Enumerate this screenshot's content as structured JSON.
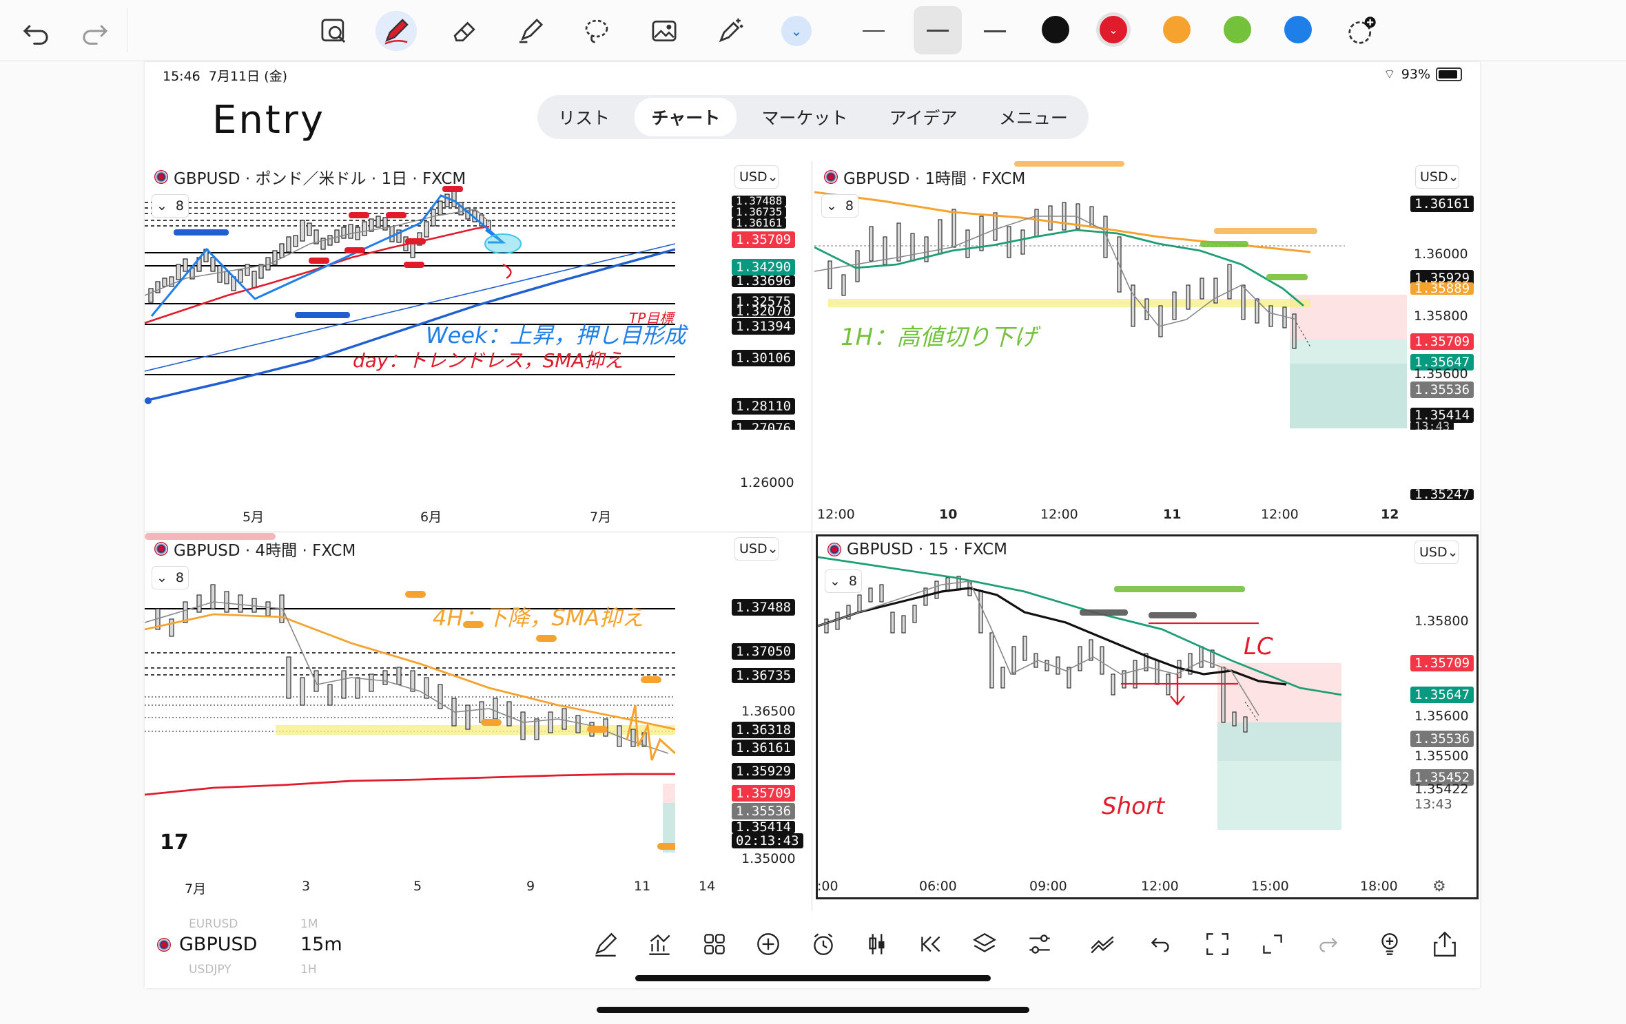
{
  "status": {
    "time": "15:46",
    "date": "7月11日 (金)",
    "battery": "93%"
  },
  "note": {
    "entry": "Entry",
    "week": "Week：上昇，押し目形成",
    "day": "day：トレンドレス，SMA抑え",
    "tp": "TP目標",
    "h1": "1H：高値切り下げ",
    "h4": "4H：下降，SMA抑え",
    "lc": "LC",
    "short": "Short"
  },
  "nav": [
    "リスト",
    "チャート",
    "マーケット",
    "アイデア",
    "メニュー"
  ],
  "currency": "USD",
  "indicators": "8",
  "colors": {
    "red": "#e01b2b",
    "orange": "#f5a22e",
    "green": "#74c13b",
    "blue": "#1f7fe8",
    "tv_red": "#f23645",
    "tv_green": "#089981"
  },
  "chart_data": [
    {
      "type": "candlestick",
      "title": "GBPUSD · ポンド／米ドル · 1日 · FXCM",
      "x_ticks": [
        "5月",
        "6月",
        "7月"
      ],
      "price_labels": [
        "1.37488",
        "1.36735",
        "1.36161",
        "1.35709",
        "1.34290",
        "1.33696",
        "1.32575",
        "1.32070",
        "1.31394",
        "1.30106",
        "1.28110",
        "1.27076",
        "1.26000"
      ]
    },
    {
      "type": "candlestick",
      "title": "GBPUSD · 1時間 · FXCM",
      "x_ticks": [
        "12:00",
        "10",
        "12:00",
        "11",
        "12:00",
        "12"
      ],
      "price_labels": [
        "1.36161",
        "1.36000",
        "1.35929",
        "1.35889",
        "1.35800",
        "1.35709",
        "1.35647",
        "1.35600",
        "1.35536",
        "1.35414",
        "13:43",
        "1.35247"
      ]
    },
    {
      "type": "candlestick",
      "title": "GBPUSD · 4時間 · FXCM",
      "x_ticks": [
        "7月",
        "3",
        "5",
        "9",
        "11",
        "14"
      ],
      "price_labels": [
        "1.37488",
        "1.37050",
        "1.36735",
        "1.36500",
        "1.36318",
        "1.36161",
        "1.35929",
        "1.35709",
        "1.35536",
        "1.35414",
        "02:13:43",
        "1.35000"
      ]
    },
    {
      "type": "candlestick",
      "title": "GBPUSD · 15 · FXCM",
      "x_ticks": [
        ":00",
        "06:00",
        "09:00",
        "12:00",
        "15:00",
        "18:00"
      ],
      "price_labels": [
        "1.35800",
        "1.35709",
        "1.35647",
        "1.35600",
        "1.35536",
        "1.35500",
        "1.35452",
        "1.35422",
        "13:43"
      ]
    }
  ],
  "bottom": {
    "symbol": "GBPUSD",
    "interval": "15m",
    "prev_symbol": "EURUSD",
    "prev_interval": "1M",
    "next_symbol": "USDJPY",
    "next_interval": "1H"
  }
}
